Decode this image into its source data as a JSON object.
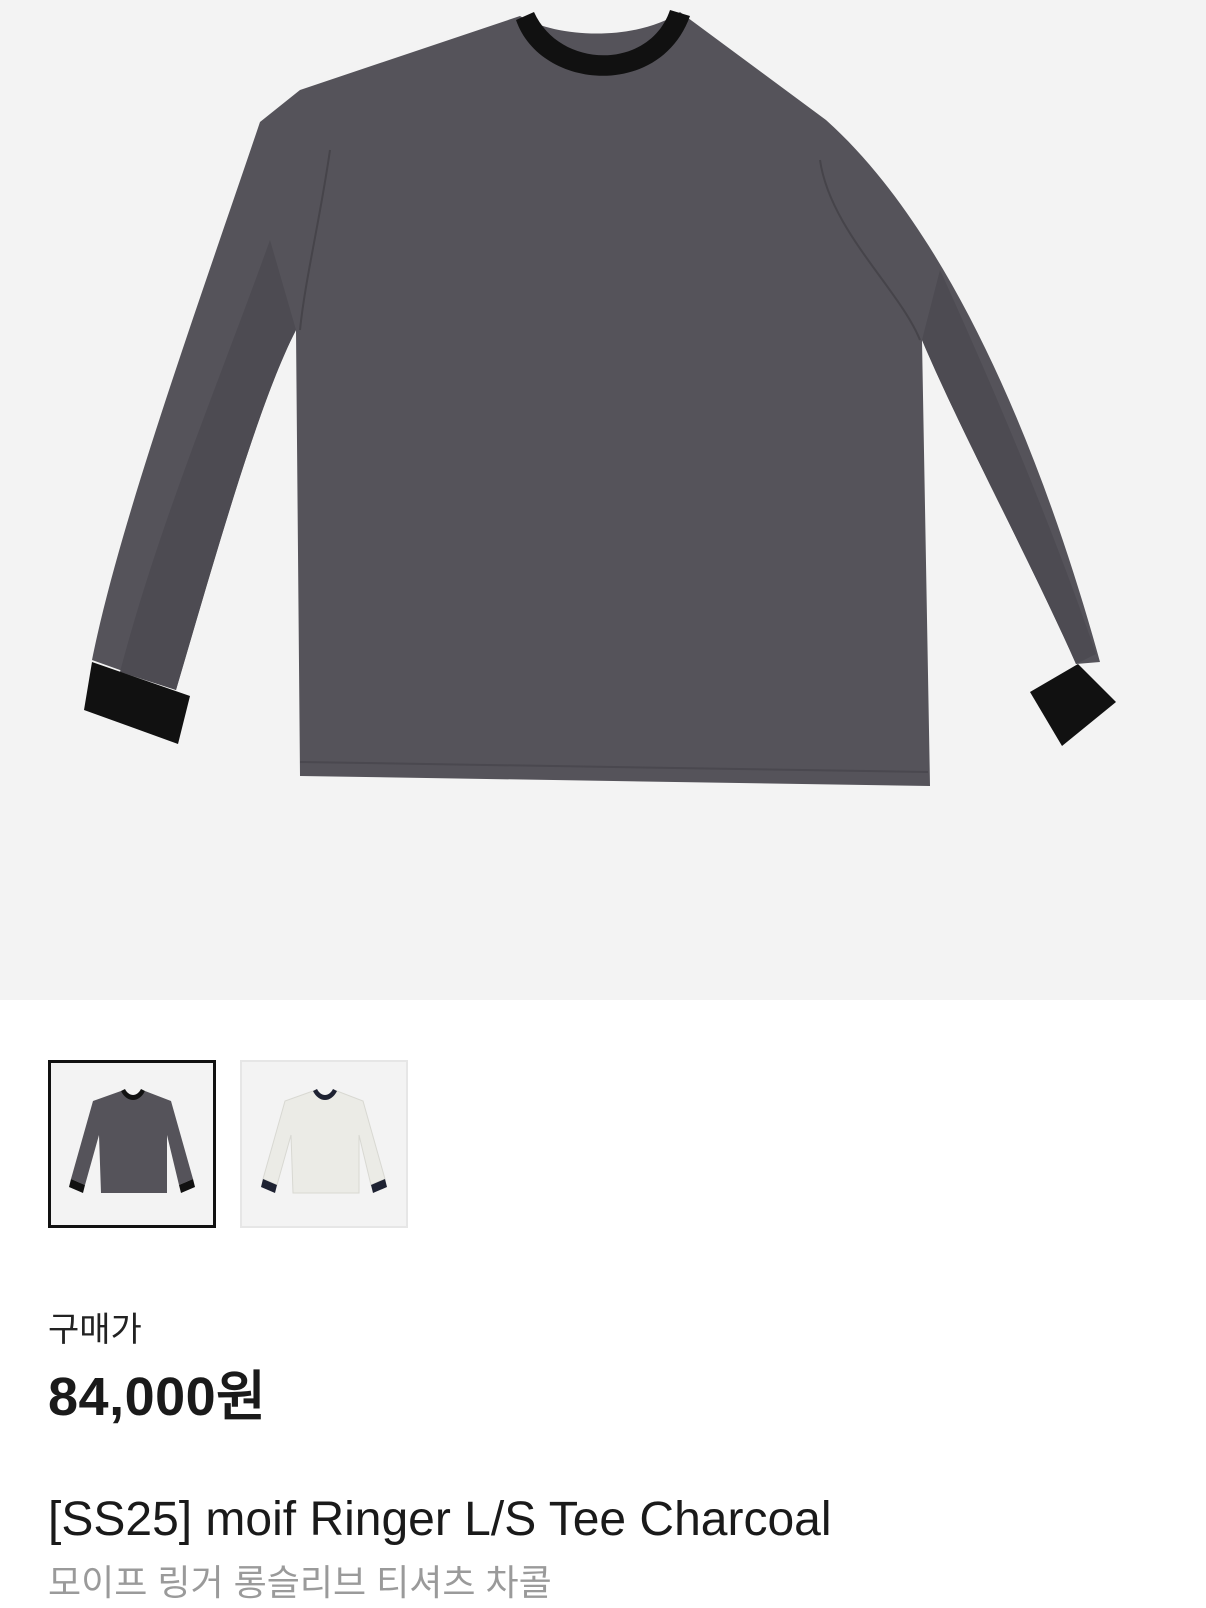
{
  "product": {
    "price_label": "구매가",
    "price": "84,000원",
    "title": "[SS25] moif Ringer L/S Tee Charcoal",
    "subtitle": "모이프 링거 롱슬리브 티셔츠 차콜"
  },
  "thumbnails": [
    {
      "color_name": "charcoal",
      "body": "#55535a",
      "trim": "#111111",
      "selected": true
    },
    {
      "color_name": "ivory",
      "body": "#ebebe6",
      "trim": "#1e2232",
      "selected": false
    }
  ],
  "colors": {
    "hero_background": "#f3f3f3",
    "shirt_body": "#55535a",
    "shirt_trim": "#111111"
  }
}
